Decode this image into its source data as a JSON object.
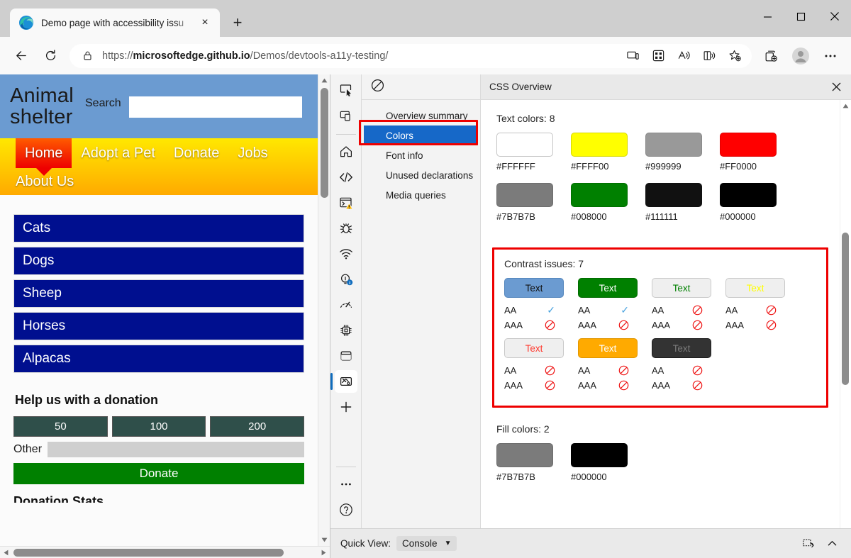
{
  "browser": {
    "tab": {
      "title": "Demo page with accessibility issu",
      "close_label": "×",
      "favicon": "edge-logo-icon"
    },
    "new_tab_label": "+",
    "window_controls": {
      "minimize": "minimize-icon",
      "maximize": "maximize-icon",
      "close": "close-icon"
    },
    "toolbar": {
      "back": "back-arrow-icon",
      "refresh": "refresh-icon",
      "lock": "lock-icon",
      "url_prefix": "https://",
      "url_host": "microsoftedge.github.io",
      "url_path": "/Demos/devtools-a11y-testing/",
      "icons": [
        "device-cast-icon",
        "app-grid-icon",
        "read-aloud-icon",
        "immersive-reader-icon",
        "add-favorite-icon"
      ],
      "right_icons": [
        "collections-icon",
        "profile-avatar-icon",
        "settings-more-icon"
      ]
    }
  },
  "webpage": {
    "site_title": "Animal shelter",
    "search_label": "Search",
    "search_value": "",
    "nav": [
      "Home",
      "Adopt a Pet",
      "Donate",
      "Jobs",
      "About Us"
    ],
    "animals": [
      "Cats",
      "Dogs",
      "Sheep",
      "Horses",
      "Alpacas"
    ],
    "donation": {
      "heading": "Help us with a donation",
      "amounts": [
        "50",
        "100",
        "200"
      ],
      "other_label": "Other",
      "other_value": "",
      "submit_label": "Donate",
      "cut_off_heading": "Donation Stats"
    },
    "scrollbars": {
      "up": "▲",
      "down": "▼",
      "left": "◀",
      "right": "▶"
    }
  },
  "devtools": {
    "activity_bar": [
      {
        "name": "inspect-element-icon"
      },
      {
        "name": "device-emulation-icon"
      },
      {
        "name": "welcome-home-icon"
      },
      {
        "name": "elements-code-icon"
      },
      {
        "name": "console-warning-icon"
      },
      {
        "name": "debugger-bug-icon"
      },
      {
        "name": "network-wifi-icon"
      },
      {
        "name": "issues-lightbulb-icon"
      },
      {
        "name": "performance-gauge-icon"
      },
      {
        "name": "memory-chip-icon"
      },
      {
        "name": "application-window-icon"
      },
      {
        "name": "css-overview-icon"
      },
      {
        "name": "add-tool-plus-icon"
      },
      {
        "name": "more-tools-icon"
      },
      {
        "name": "help-question-icon"
      }
    ],
    "panel_title": "CSS Overview",
    "clear_overview_icon": "no-entry-icon",
    "close_icon": "✕",
    "nav_items": [
      "Overview summary",
      "Colors",
      "Font info",
      "Unused declarations",
      "Media queries"
    ],
    "nav_selected": "Colors",
    "sections": {
      "text_colors": {
        "title": "Text colors: 8",
        "swatches": [
          {
            "hex": "#FFFFFF",
            "label": "#FFFFFF"
          },
          {
            "hex": "#FFFF00",
            "label": "#FFFF00"
          },
          {
            "hex": "#999999",
            "label": "#999999"
          },
          {
            "hex": "#FF0000",
            "label": "#FF0000"
          },
          {
            "hex": "#7B7B7B",
            "label": "#7B7B7B"
          },
          {
            "hex": "#008000",
            "label": "#008000"
          },
          {
            "hex": "#111111",
            "label": "#111111"
          },
          {
            "hex": "#000000",
            "label": "#000000"
          }
        ]
      },
      "contrast_issues": {
        "title": "Contrast issues: 7",
        "sample_text": "Text",
        "aa_label": "AA",
        "aaa_label": "AAA",
        "items": [
          {
            "bg": "#6B9BD1",
            "fg": "#111111",
            "border": "#5587bd",
            "aa": "pass",
            "aaa": "fail"
          },
          {
            "bg": "#008000",
            "fg": "#FFFFFF",
            "border": "#006a00",
            "aa": "pass",
            "aaa": "fail"
          },
          {
            "bg": "#EFEFEF",
            "fg": "#008000",
            "border": "#c9c9c9",
            "aa": "fail",
            "aaa": "fail"
          },
          {
            "bg": "#EFEFEF",
            "fg": "#FFFF00",
            "border": "#c9c9c9",
            "aa": "fail",
            "aaa": "fail"
          },
          {
            "bg": "#EFEFEF",
            "fg": "#FF0000",
            "border": "#c9c9c9",
            "aa": "fail",
            "aaa": "fail"
          },
          {
            "bg": "#FFAA00",
            "fg": "#FFFFFF",
            "border": "#e09600",
            "aa": "fail",
            "aaa": "fail"
          },
          {
            "bg": "#333333",
            "fg": "#7B7B7B",
            "border": "#1d1d1d",
            "aa": "fail",
            "aaa": "fail"
          }
        ]
      },
      "fill_colors": {
        "title": "Fill colors: 2",
        "swatches": [
          {
            "hex": "#7B7B7B",
            "label": "#7B7B7B"
          },
          {
            "hex": "#000000",
            "label": "#000000"
          }
        ]
      }
    },
    "status_bar": {
      "quick_view_label": "Quick View:",
      "quick_view_value": "Console",
      "caret": "▼",
      "right_icons": [
        "dock-side-icon",
        "collapse-chevron-icon"
      ]
    }
  },
  "accents": {
    "highlight_red": "#EE0000",
    "selection_blue": "#1668C8",
    "site_blue": "#6B9BD1",
    "nav_yellow": "#FFE800",
    "nav_orange": "#FFAA00",
    "animal_navy": "#000F8F",
    "donate_green": "#008000"
  }
}
